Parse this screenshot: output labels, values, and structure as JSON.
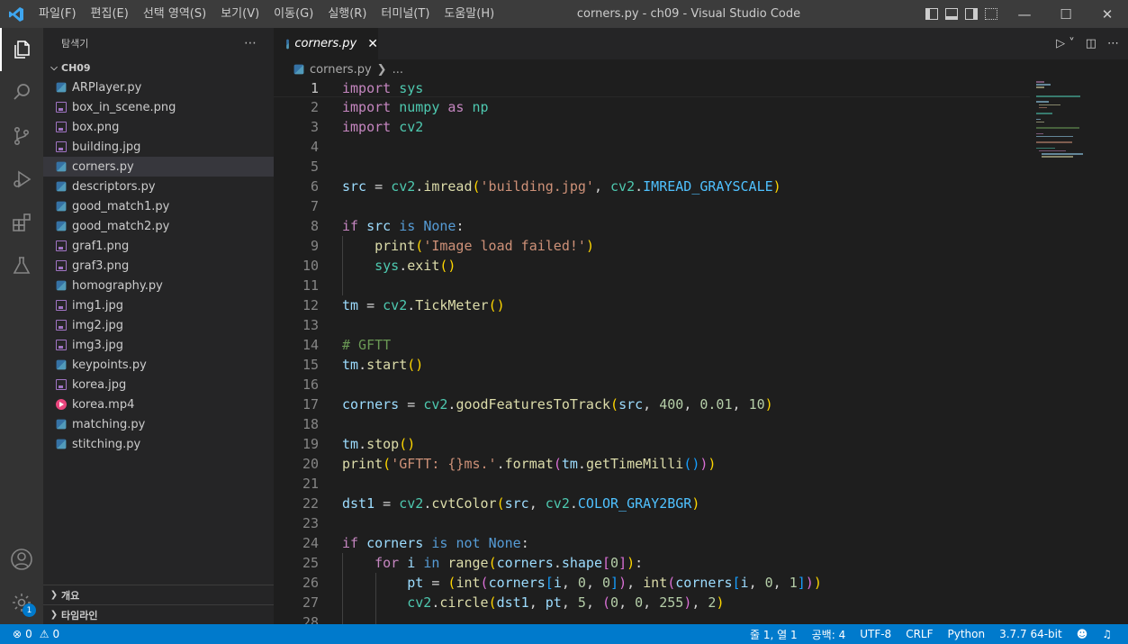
{
  "titlebar": {
    "menu": [
      "파일(F)",
      "편집(E)",
      "선택 영역(S)",
      "보기(V)",
      "이동(G)",
      "실행(R)",
      "터미널(T)",
      "도움말(H)"
    ],
    "title": "corners.py - ch09 - Visual Studio Code"
  },
  "sidebar": {
    "title": "탐색기",
    "folder": "CH09",
    "files": [
      {
        "name": "ARPlayer.py",
        "type": "py"
      },
      {
        "name": "box_in_scene.png",
        "type": "img"
      },
      {
        "name": "box.png",
        "type": "img"
      },
      {
        "name": "building.jpg",
        "type": "img"
      },
      {
        "name": "corners.py",
        "type": "py"
      },
      {
        "name": "descriptors.py",
        "type": "py"
      },
      {
        "name": "good_match1.py",
        "type": "py"
      },
      {
        "name": "good_match2.py",
        "type": "py"
      },
      {
        "name": "graf1.png",
        "type": "img"
      },
      {
        "name": "graf3.png",
        "type": "img"
      },
      {
        "name": "homography.py",
        "type": "py"
      },
      {
        "name": "img1.jpg",
        "type": "img"
      },
      {
        "name": "img2.jpg",
        "type": "img"
      },
      {
        "name": "img3.jpg",
        "type": "img"
      },
      {
        "name": "keypoints.py",
        "type": "py"
      },
      {
        "name": "korea.jpg",
        "type": "img"
      },
      {
        "name": "korea.mp4",
        "type": "vid"
      },
      {
        "name": "matching.py",
        "type": "py"
      },
      {
        "name": "stitching.py",
        "type": "py"
      }
    ],
    "outline": "개요",
    "timeline": "타임라인"
  },
  "tab": {
    "label": "corners.py"
  },
  "breadcrumb": {
    "file": "corners.py",
    "more": "..."
  },
  "editor": {
    "current_line": 1,
    "lines": [
      "import sys",
      "import numpy as np",
      "import cv2",
      "",
      "",
      "src = cv2.imread('building.jpg', cv2.IMREAD_GRAYSCALE)",
      "",
      "if src is None:",
      "    print('Image load failed!')",
      "    sys.exit()",
      "",
      "tm = cv2.TickMeter()",
      "",
      "# GFTT",
      "tm.start()",
      "",
      "corners = cv2.goodFeaturesToTrack(src, 400, 0.01, 10)",
      "",
      "tm.stop()",
      "print('GFTT: {}ms.'.format(tm.getTimeMilli()))",
      "",
      "dst1 = cv2.cvtColor(src, cv2.COLOR_GRAY2BGR)",
      "",
      "if corners is not None:",
      "    for i in range(corners.shape[0]):",
      "        pt = (int(corners[i, 0, 0]), int(corners[i, 0, 1]))",
      "        cv2.circle(dst1, pt, 5, (0, 0, 255), 2)",
      ""
    ]
  },
  "statusbar": {
    "errors": "0",
    "warnings": "0",
    "position": "줄 1, 열 1",
    "indent": "공백: 4",
    "encoding": "UTF-8",
    "eol": "CRLF",
    "language": "Python",
    "interpreter": "3.7.7 64-bit"
  },
  "activity": {
    "settings_badge": "1"
  },
  "colors": {
    "statusbar": "#007acc",
    "accent": "#007acc"
  },
  "icons": [
    "vscode-logo-icon",
    "explorer-icon",
    "search-icon",
    "source-control-icon",
    "run-debug-icon",
    "extensions-icon",
    "testing-icon",
    "account-icon",
    "settings-gear-icon",
    "run-icon",
    "split-editor-icon",
    "more-icon",
    "close-icon",
    "error-icon",
    "warning-icon",
    "feedback-icon",
    "bell-icon"
  ]
}
